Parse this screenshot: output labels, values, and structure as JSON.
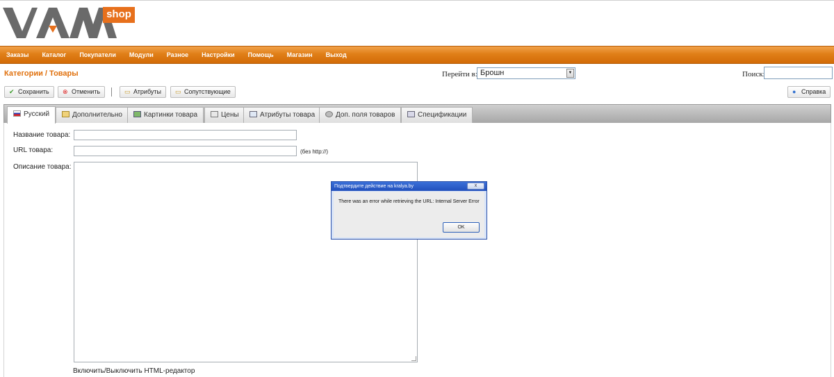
{
  "brand": {
    "logo_text": "VAM",
    "shop_badge": "shop",
    "accent": "#e7701c",
    "logo_gray": "#6a6a6a"
  },
  "nav": {
    "items": [
      "Заказы",
      "Каталог",
      "Покупатели",
      "Модули",
      "Разное",
      "Настройки",
      "Помощь",
      "Магазин",
      "Выход"
    ]
  },
  "toolbar": {
    "breadcrumb": "Категории / Товары",
    "goto_label": "Перейти в:",
    "goto_value": "Брошн",
    "search_label": "Поиск:",
    "search_value": "",
    "save_label": "Сохранить",
    "cancel_label": "Отменить",
    "attributes_label": "Атрибуты",
    "related_label": "Сопутствующие",
    "help_label": "Справка"
  },
  "tabs": [
    {
      "label": "Русский",
      "icon": "flag-ru-icon"
    },
    {
      "label": "Дополнительно",
      "icon": "extra-icon"
    },
    {
      "label": "Картинки товара",
      "icon": "picture-icon"
    },
    {
      "label": "Цены",
      "icon": "price-icon"
    },
    {
      "label": "Атрибуты товара",
      "icon": "attributes-icon"
    },
    {
      "label": "Доп. поля товаров",
      "icon": "gear-icon"
    },
    {
      "label": "Спецификации",
      "icon": "spec-icon"
    }
  ],
  "form": {
    "name_label": "Название товара:",
    "name_value": "",
    "url_label": "URL товара:",
    "url_value": "",
    "url_hint": "(без http://)",
    "description_label": "Описание товара:",
    "description_value": "",
    "html_toggle": "Включить/Выключить HTML-редактор"
  },
  "dialog": {
    "title": "Подтвердите действие на kralya.by",
    "message": "There was an error while retrieving the URL: Internal Server Error",
    "ok_label": "OK",
    "close_glyph": "x"
  }
}
